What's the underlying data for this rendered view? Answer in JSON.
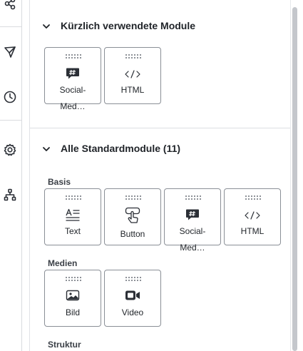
{
  "sidebar_rail": {
    "icons": [
      "share-icon",
      "send-icon",
      "history-icon",
      "settings-icon",
      "sitemap-icon"
    ]
  },
  "recent": {
    "title": "Kürzlich verwendete Module",
    "modules": [
      {
        "label_line1": "Social-",
        "label_line2": "Med…",
        "icon": "hashtag-chat-icon"
      },
      {
        "label_line1": "HTML",
        "label_line2": "",
        "icon": "code-icon"
      }
    ]
  },
  "standard": {
    "title": "Alle Standardmodule (11)",
    "groups": [
      {
        "label": "Basis",
        "modules": [
          {
            "label_line1": "Text",
            "label_line2": "",
            "icon": "text-icon"
          },
          {
            "label_line1": "Button",
            "label_line2": "",
            "icon": "button-icon"
          },
          {
            "label_line1": "Social-",
            "label_line2": "Med…",
            "icon": "hashtag-chat-icon"
          },
          {
            "label_line1": "HTML",
            "label_line2": "",
            "icon": "code-icon"
          }
        ]
      },
      {
        "label": "Medien",
        "modules": [
          {
            "label_line1": "Bild",
            "label_line2": "",
            "icon": "image-icon"
          },
          {
            "label_line1": "Video",
            "label_line2": "",
            "icon": "video-icon"
          }
        ]
      },
      {
        "label": "Struktur",
        "modules": []
      }
    ]
  },
  "colors": {
    "tile_border": "#8a8f96",
    "text": "#1f2328",
    "divider": "#d9dbdf"
  }
}
